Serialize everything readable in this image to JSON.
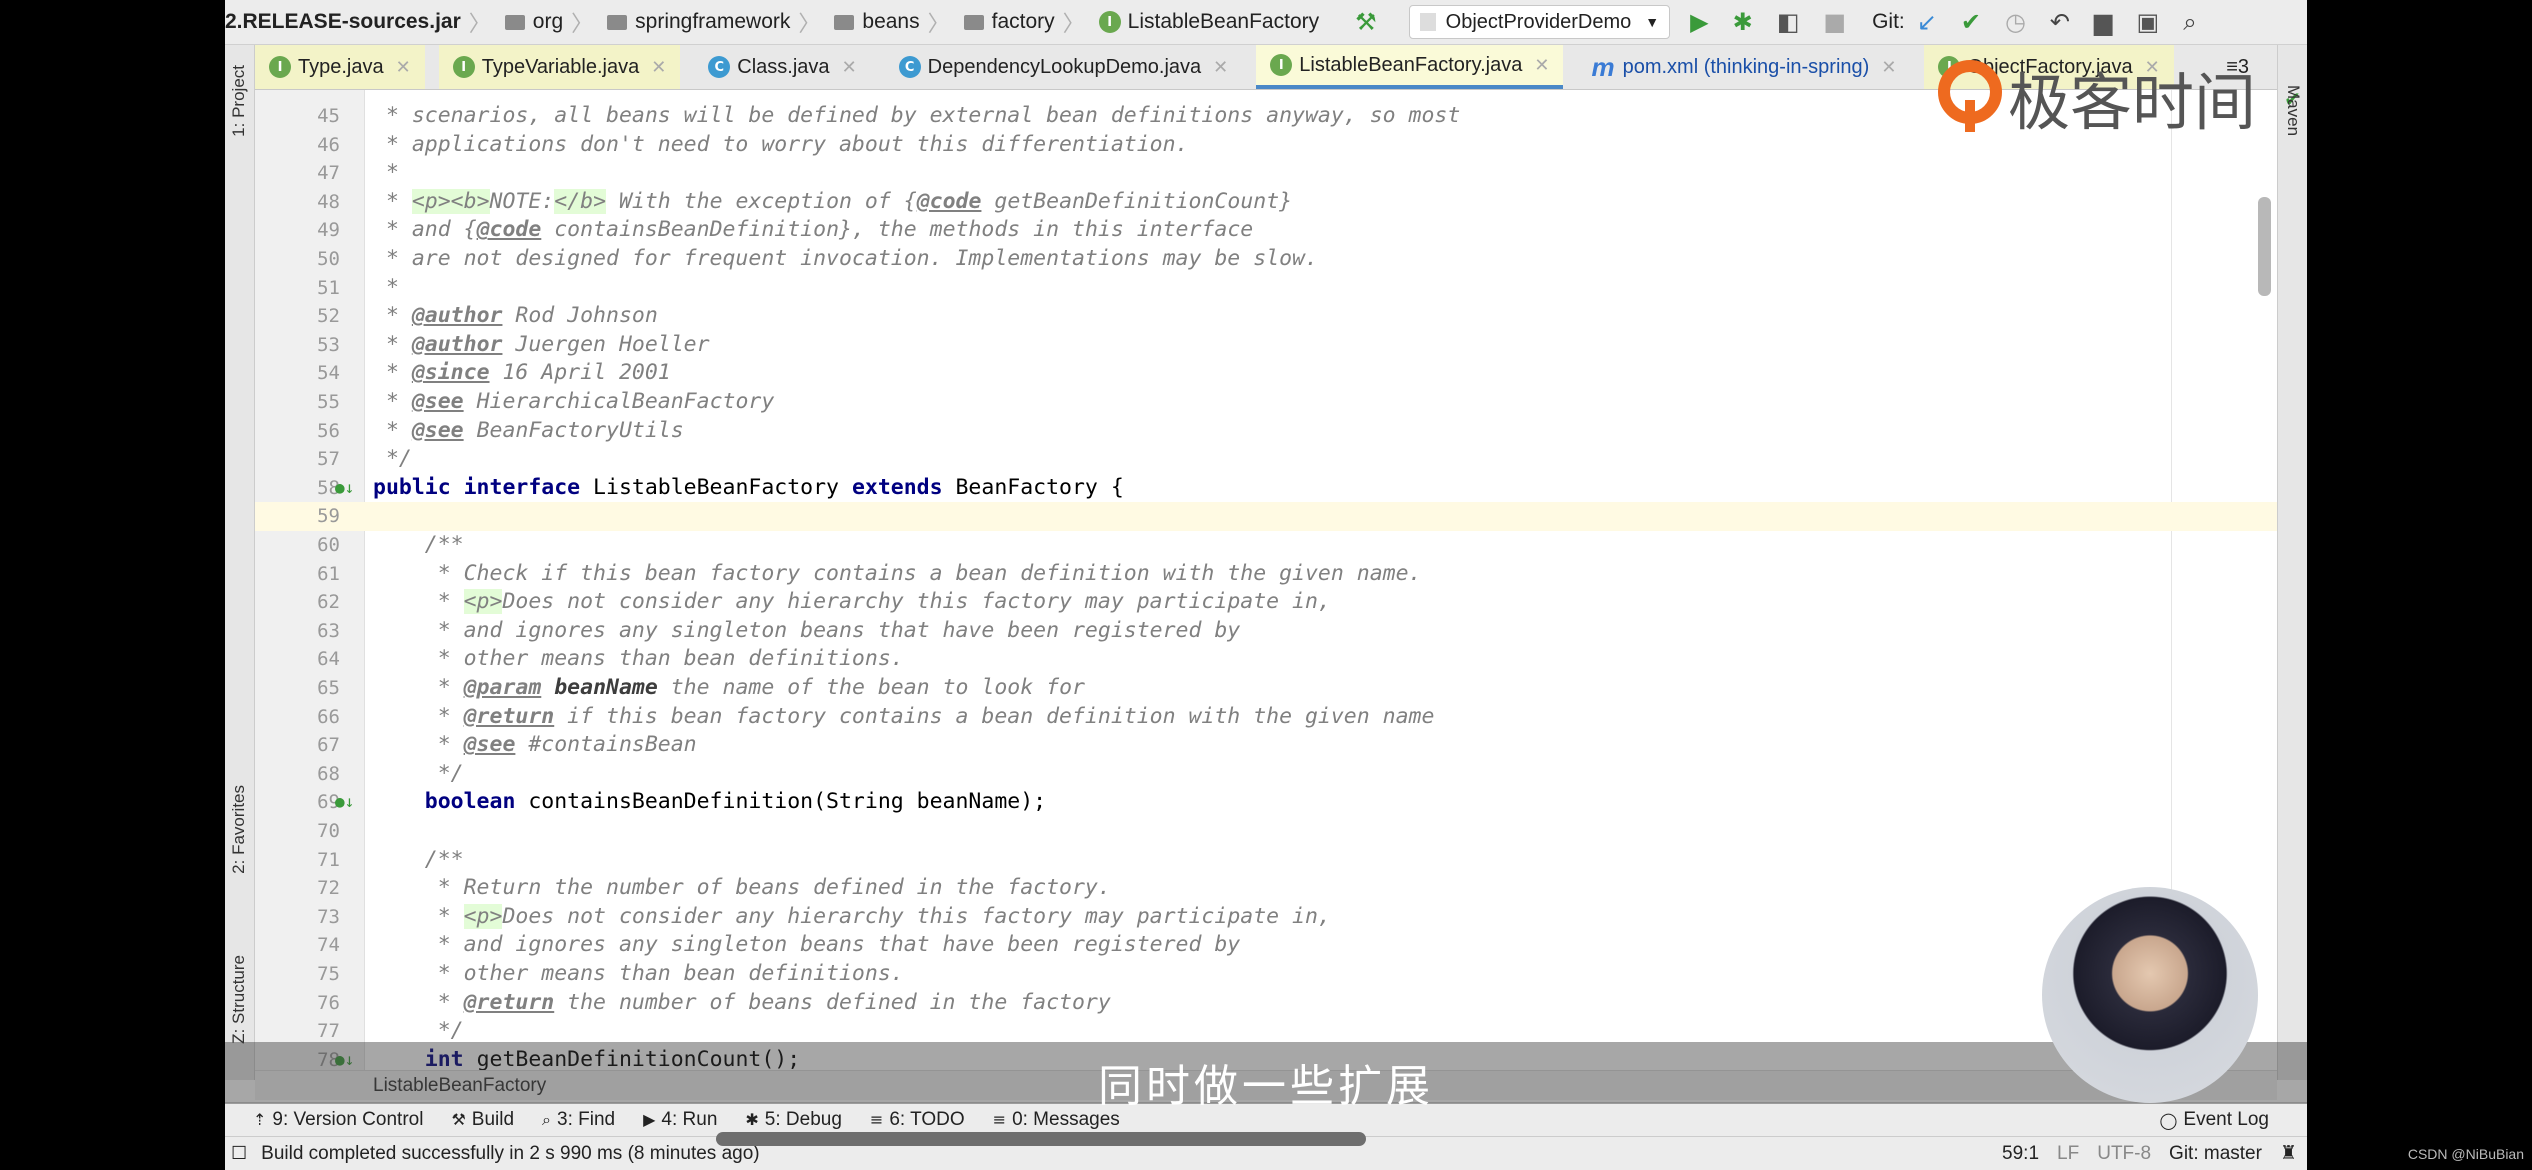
{
  "breadcrumb": [
    "2.RELEASE-sources.jar",
    "org",
    "springframework",
    "beans",
    "factory",
    "ListableBeanFactory"
  ],
  "run_config": "ObjectProviderDemo",
  "git_label": "Git:",
  "tabs": [
    {
      "label": "Type.java",
      "kind": "I"
    },
    {
      "label": "TypeVariable.java",
      "kind": "I"
    },
    {
      "label": "Class.java",
      "kind": "C"
    },
    {
      "label": "DependencyLookupDemo.java",
      "kind": "C"
    },
    {
      "label": "ListableBeanFactory.java",
      "kind": "I",
      "active": true
    },
    {
      "label": "pom.xml (thinking-in-spring)",
      "kind": "m"
    },
    {
      "label": "ObjectFactory.java",
      "kind": "I"
    }
  ],
  "tab_overflow": "≡3",
  "left_tools": [
    "1: Project",
    "2: Favorites",
    "Z: Structure"
  ],
  "right_tools": [
    "Maven"
  ],
  "code": [
    {
      "n": 45,
      "s": [
        [
          " * scenarios, all beans will be defined by external bean definitions anyway, so most",
          "c"
        ]
      ]
    },
    {
      "n": 46,
      "s": [
        [
          " * applications don't need to worry about this differentiation.",
          "c"
        ]
      ]
    },
    {
      "n": 47,
      "s": [
        [
          " *",
          "c"
        ]
      ]
    },
    {
      "n": 48,
      "s": [
        [
          " * ",
          "c"
        ],
        [
          "<p><b>",
          "ht"
        ],
        [
          "NOTE:",
          "c"
        ],
        [
          "</b>",
          "ht"
        ],
        [
          " With the exception of {",
          "c"
        ],
        [
          "@code",
          "tag"
        ],
        [
          " getBeanDefinitionCount}",
          "c"
        ]
      ]
    },
    {
      "n": 49,
      "s": [
        [
          " * and {",
          "c"
        ],
        [
          "@code",
          "tag"
        ],
        [
          " containsBeanDefinition}, the methods in this interface",
          "c"
        ]
      ]
    },
    {
      "n": 50,
      "s": [
        [
          " * are not designed for frequent invocation. Implementations may be slow.",
          "c"
        ]
      ]
    },
    {
      "n": 51,
      "s": [
        [
          " *",
          "c"
        ]
      ]
    },
    {
      "n": 52,
      "s": [
        [
          " * ",
          "c"
        ],
        [
          "@author",
          "tag"
        ],
        [
          " Rod Johnson",
          "c"
        ]
      ]
    },
    {
      "n": 53,
      "s": [
        [
          " * ",
          "c"
        ],
        [
          "@author",
          "tag"
        ],
        [
          " Juergen Hoeller",
          "c"
        ]
      ]
    },
    {
      "n": 54,
      "s": [
        [
          " * ",
          "c"
        ],
        [
          "@since",
          "tag"
        ],
        [
          " 16 April 2001",
          "c"
        ]
      ]
    },
    {
      "n": 55,
      "s": [
        [
          " * ",
          "c"
        ],
        [
          "@see",
          "tag"
        ],
        [
          " HierarchicalBeanFactory",
          "c"
        ]
      ]
    },
    {
      "n": 56,
      "s": [
        [
          " * ",
          "c"
        ],
        [
          "@see",
          "tag"
        ],
        [
          " BeanFactoryUtils",
          "c"
        ]
      ]
    },
    {
      "n": 57,
      "s": [
        [
          " */",
          "c"
        ]
      ]
    },
    {
      "n": 58,
      "s": [
        [
          "public interface",
          "kw"
        ],
        [
          " ListableBeanFactory ",
          "tx"
        ],
        [
          "extends",
          "kw"
        ],
        [
          " BeanFactory {",
          "tx"
        ]
      ],
      "icon": true
    },
    {
      "n": 59,
      "s": [],
      "current": true
    },
    {
      "n": 60,
      "s": [
        [
          "    /**",
          "c"
        ]
      ]
    },
    {
      "n": 61,
      "s": [
        [
          "     * Check if this bean factory contains a bean definition with the given name.",
          "c"
        ]
      ]
    },
    {
      "n": 62,
      "s": [
        [
          "     * ",
          "c"
        ],
        [
          "<p>",
          "ht"
        ],
        [
          "Does not consider any hierarchy this factory may participate in,",
          "c"
        ]
      ]
    },
    {
      "n": 63,
      "s": [
        [
          "     * and ignores any singleton beans that have been registered by",
          "c"
        ]
      ]
    },
    {
      "n": 64,
      "s": [
        [
          "     * other means than bean definitions.",
          "c"
        ]
      ]
    },
    {
      "n": 65,
      "s": [
        [
          "     * ",
          "c"
        ],
        [
          "@param",
          "tag"
        ],
        [
          " ",
          "c"
        ],
        [
          "beanName",
          "bn"
        ],
        [
          " the name of the bean to look for",
          "c"
        ]
      ]
    },
    {
      "n": 66,
      "s": [
        [
          "     * ",
          "c"
        ],
        [
          "@return",
          "tag"
        ],
        [
          " if this bean factory contains a bean definition with the given name",
          "c"
        ]
      ]
    },
    {
      "n": 67,
      "s": [
        [
          "     * ",
          "c"
        ],
        [
          "@see",
          "tag"
        ],
        [
          " #containsBean",
          "c"
        ]
      ]
    },
    {
      "n": 68,
      "s": [
        [
          "     */",
          "c"
        ]
      ]
    },
    {
      "n": 69,
      "s": [
        [
          "    ",
          "tx"
        ],
        [
          "boolean",
          "kw"
        ],
        [
          " containsBeanDefinition(String beanName);",
          "tx"
        ]
      ],
      "icon": true
    },
    {
      "n": 70,
      "s": []
    },
    {
      "n": 71,
      "s": [
        [
          "    /**",
          "c"
        ]
      ]
    },
    {
      "n": 72,
      "s": [
        [
          "     * Return the number of beans defined in the factory.",
          "c"
        ]
      ]
    },
    {
      "n": 73,
      "s": [
        [
          "     * ",
          "c"
        ],
        [
          "<p>",
          "ht"
        ],
        [
          "Does not consider any hierarchy this factory may participate in,",
          "c"
        ]
      ]
    },
    {
      "n": 74,
      "s": [
        [
          "     * and ignores any singleton beans that have been registered by",
          "c"
        ]
      ]
    },
    {
      "n": 75,
      "s": [
        [
          "     * other means than bean definitions.",
          "c"
        ]
      ]
    },
    {
      "n": 76,
      "s": [
        [
          "     * ",
          "c"
        ],
        [
          "@return",
          "tag"
        ],
        [
          " the number of beans defined in the factory",
          "c"
        ]
      ]
    },
    {
      "n": 77,
      "s": [
        [
          "     */",
          "c"
        ]
      ]
    },
    {
      "n": 78,
      "s": [
        [
          "    ",
          "tx"
        ],
        [
          "int",
          "kw"
        ],
        [
          " getBeanDefinitionCount();",
          "tx"
        ]
      ],
      "icon": true
    }
  ],
  "editor_breadcrumb": "ListableBeanFactory",
  "tool_windows": [
    {
      "label": "9: Version Control",
      "icon": "⇡"
    },
    {
      "label": "Build",
      "icon": "⚒"
    },
    {
      "label": "3: Find",
      "icon": "⌕"
    },
    {
      "label": "4: Run",
      "icon": "▶"
    },
    {
      "label": "5: Debug",
      "icon": "✱"
    },
    {
      "label": "6: TODO",
      "icon": "≡"
    },
    {
      "label": "0: Messages",
      "icon": "≡"
    }
  ],
  "event_log": "Event Log",
  "status": {
    "message": "Build completed successfully in 2 s 990 ms (8 minutes ago)",
    "position": "59:1",
    "line_sep": "LF",
    "encoding": "UTF-8",
    "vcs": "Git: master"
  },
  "subtitle": "同时做一些扩展",
  "logo_text": "极客时间",
  "watermark": "CSDN @NiBuBian"
}
